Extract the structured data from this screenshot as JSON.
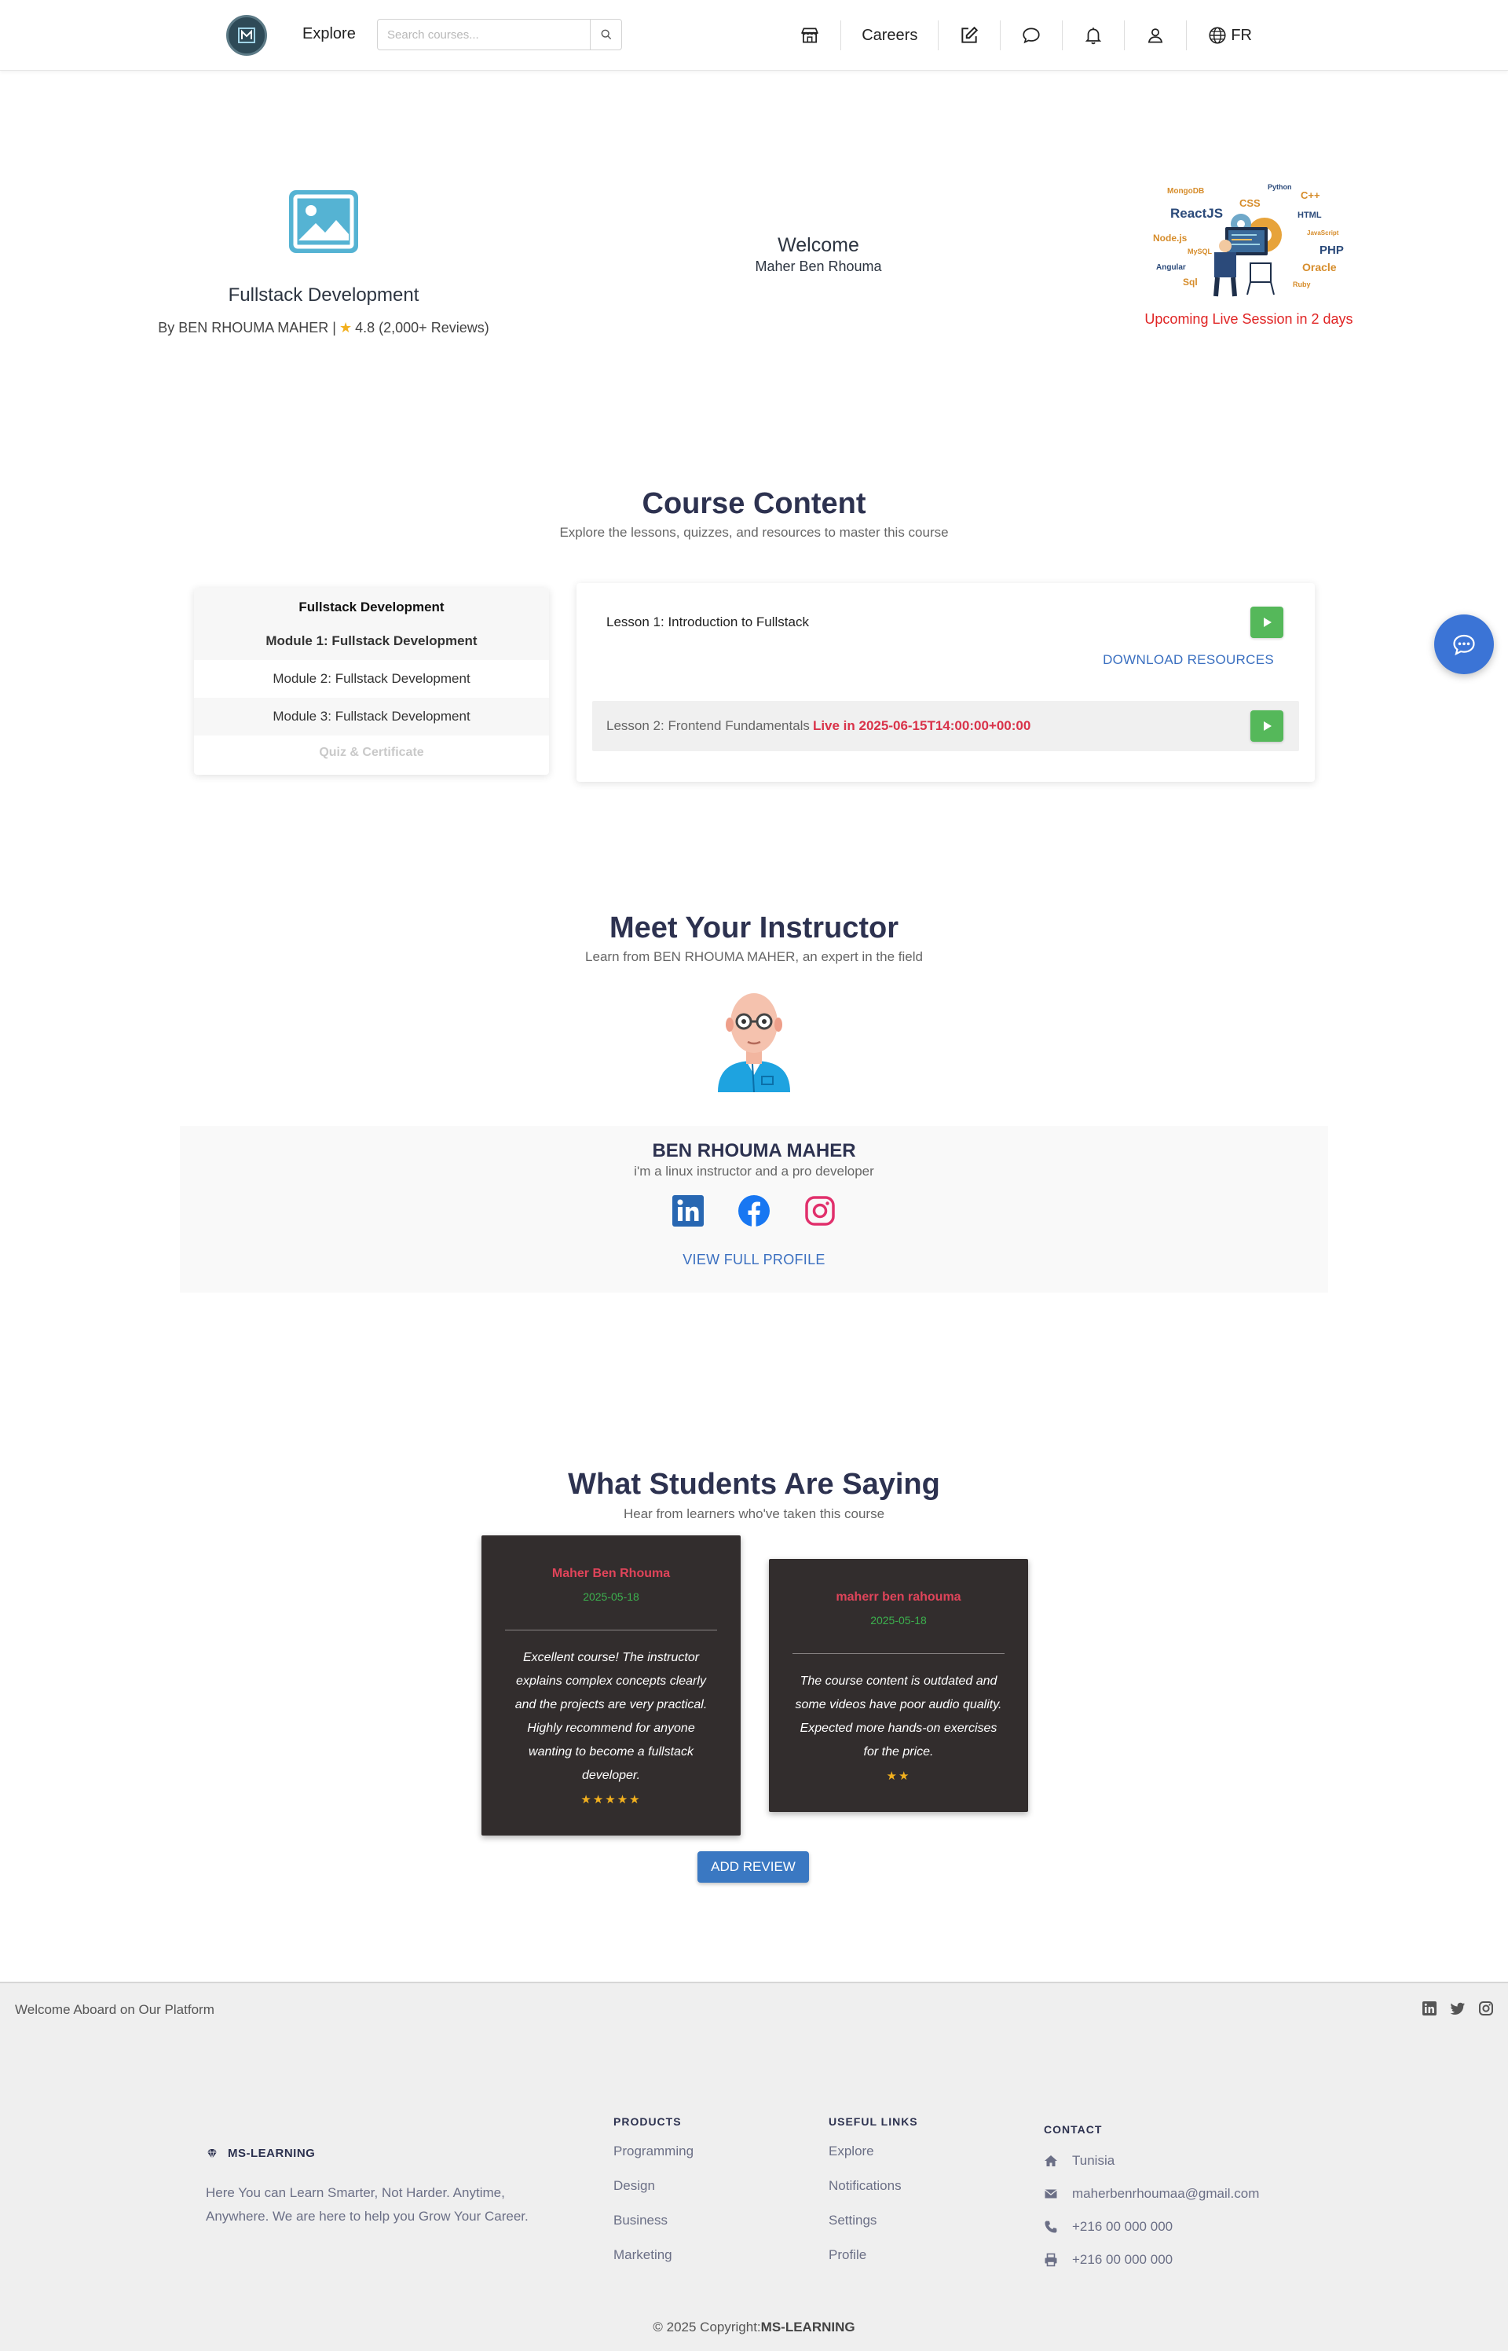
{
  "navbar": {
    "explore": "Explore",
    "search_placeholder": "Search courses...",
    "careers": "Careers",
    "lang": "FR"
  },
  "hero": {
    "course_title": "Fullstack Development",
    "by_prefix": "By BEN RHOUMA MAHER |",
    "rating": "4.8 (2,000+ Reviews)",
    "welcome_title": "Welcome",
    "welcome_name": "Maher Ben Rhouma",
    "tech_words": [
      "MongoDB",
      "Python",
      "C++",
      "CSS",
      "ReactJS",
      "HTML",
      "Node.js",
      "JavaScript",
      "MySQL",
      "PHP",
      "Angular",
      "Oracle",
      "Sql",
      "Ruby"
    ],
    "upcoming": "Upcoming Live Session in 2 days"
  },
  "course_content": {
    "title": "Course Content",
    "subtitle": "Explore the lessons, quizzes, and resources to master this course",
    "modules_header": "Fullstack Development",
    "modules": [
      "Module 1: Fullstack Development",
      "Module 2: Fullstack Development",
      "Module 3: Fullstack Development"
    ],
    "quiz": "Quiz & Certificate",
    "lesson1": "Lesson 1: Introduction to Fullstack",
    "download": "DOWNLOAD RESOURCES",
    "lesson2": "Lesson 2: Frontend Fundamentals",
    "lesson2_live": "Live in 2025-06-15T14:00:00+00:00"
  },
  "instructor": {
    "title": "Meet Your Instructor",
    "subtitle": "Learn from BEN RHOUMA MAHER, an expert in the field",
    "name": "BEN RHOUMA MAHER",
    "bio": "i'm a linux instructor and a pro developer",
    "profile_link": "VIEW FULL PROFILE"
  },
  "reviews": {
    "title": "What Students Are Saying",
    "subtitle": "Hear from learners who've taken this course",
    "items": [
      {
        "name": "Maher Ben Rhouma",
        "date": "2025-05-18",
        "text": "Excellent course! The instructor explains complex concepts clearly and the projects are very practical. Highly recommend for anyone wanting to become a fullstack developer.",
        "stars": "★★★★★",
        "rating": 5
      },
      {
        "name": "maherr ben rahouma",
        "date": "2025-05-18",
        "text": "The course content is outdated and some videos have poor audio quality. Expected more hands-on exercises for the price.",
        "stars": "★★",
        "rating": 2
      }
    ],
    "add_button": "ADD REVIEW"
  },
  "footer": {
    "welcome": "Welcome Aboard on Our Platform",
    "brand": "MS-LEARNING",
    "brand_desc": "Here You can Learn Smarter, Not Harder. Anytime, Anywhere. We are here to help you Grow Your Career.",
    "products_head": "PRODUCTS",
    "products": [
      "Programming",
      "Design",
      "Business",
      "Marketing"
    ],
    "links_head": "USEFUL LINKS",
    "links": [
      "Explore",
      "Notifications",
      "Settings",
      "Profile"
    ],
    "contact_head": "CONTACT",
    "contact": {
      "location": "Tunisia",
      "email": "maherbenrhoumaa@gmail.com",
      "phone": "+216 00 000 000",
      "fax": "+216 00 000 000"
    },
    "copyright_prefix": "© 2025 Copyright:",
    "copyright_brand": "MS-LEARNING"
  },
  "colors": {
    "accent_blue": "#3a78c2",
    "play_green": "#55b85a",
    "live_red": "#d9334a",
    "review_bg": "#322d2d",
    "heading": "#2d3250"
  }
}
